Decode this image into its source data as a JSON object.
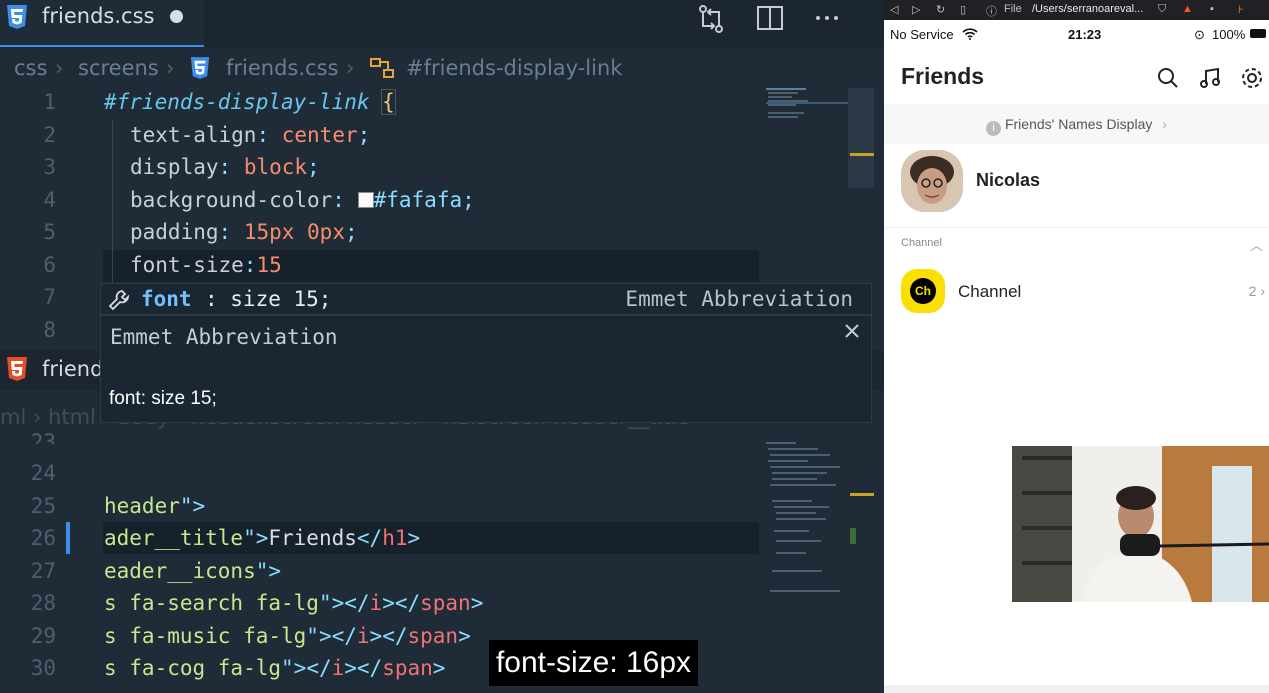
{
  "editor": {
    "tab": {
      "label": "friends.css"
    },
    "breadcrumb": {
      "part1": "css",
      "part2": "screens",
      "part3": "friends.css",
      "part4": "#friends-display-link"
    },
    "css_lines": [
      {
        "n": "1"
      },
      {
        "n": "2"
      },
      {
        "n": "3"
      },
      {
        "n": "4"
      },
      {
        "n": "5"
      },
      {
        "n": "6"
      },
      {
        "n": "7"
      },
      {
        "n": "8"
      }
    ],
    "css_code": {
      "l1_sel": "#friends-display-link",
      "l1_brace": "{",
      "l2_prop": "text-align",
      "l2_val": "center",
      "l3_prop": "display",
      "l3_val": "block",
      "l4_prop": "background-color",
      "l4_val": "#fafafa",
      "l5_prop": "padding",
      "l5_val": "15px 0px",
      "l6_prop": "font-size",
      "l6_val": "15",
      "colon": ":",
      "semi": ";"
    },
    "suggest": {
      "item_bold": "font",
      "item_rest": ": size 15;",
      "item_type": "Emmet Abbreviation",
      "detail_title": "Emmet Abbreviation",
      "detail_body": "font: size 15;"
    },
    "pane2": {
      "tab_label": "friend",
      "breadcrumb": "ml  ›  html  ›  body  ›  header.screen-header  ›  h1.screen-header__title"
    },
    "html_lines": {
      "n23": "23",
      "n24": "24",
      "n25": "25",
      "n26": "26",
      "n27": "27",
      "n28": "28",
      "n29": "29",
      "n30": "30",
      "l25a": "header",
      "l25b": "\">",
      "l26a": "ader__title",
      "l26b": "\">",
      "l26c": "Friends",
      "l26d": "</",
      "l26e": "h1",
      "l26f": ">",
      "l27a": "eader__icons",
      "l27b": "\">",
      "l28a": "s fa-search fa-lg",
      "l28b": "\">",
      "l28c": "</",
      "l28d": "i",
      "l28e": "></",
      "l28f": "span",
      "l28g": ">",
      "l29a": "s fa-music fa-lg",
      "l29b": "\">",
      "l29c": "</",
      "l29d": "i",
      "l29e": "></",
      "l29f": "span",
      "l29g": ">",
      "l30a": "s fa-cog fa-lg",
      "l30b": "\">",
      "l30c": "</",
      "l30d": "i",
      "l30e": "></",
      "l30f": "span",
      "l30g": ">"
    },
    "caption": "font-size: 16px"
  },
  "browser": {
    "bar": {
      "file_label": "File",
      "path": "/Users/serranoareval..."
    },
    "status": {
      "carrier": "No Service",
      "time": "21:23",
      "battery": "100%"
    },
    "app": {
      "title": "Friends",
      "names_link": "Friends' Names Display",
      "profile_name": "Nicolas",
      "section": "Channel",
      "channel_name": "Channel",
      "channel_logo": "Ch",
      "channel_count": "2"
    }
  },
  "colors": {
    "accent": "#3b8eea",
    "editor_bg": "#1f2c38",
    "kakao_yellow": "#f9e000"
  },
  "icons": [
    "css3-icon",
    "compare-icon",
    "split-editor-icon",
    "more-icon",
    "wrench-icon",
    "close-icon",
    "html5-icon",
    "search-icon",
    "music-icon",
    "gear-icon",
    "info-icon",
    "chevron-right-icon",
    "chevron-up-icon",
    "wifi-icon"
  ]
}
